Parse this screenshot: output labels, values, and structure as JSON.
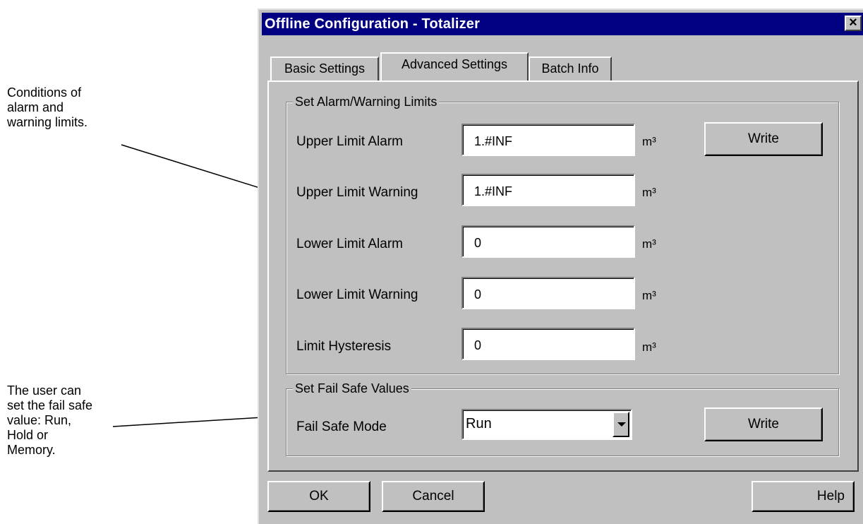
{
  "annotations": {
    "alarm_note": [
      "Conditions of",
      "alarm and",
      "warning limits."
    ],
    "failsafe_note": [
      "The user can",
      "set the fail safe",
      "value: Run,",
      "Hold or",
      "Memory."
    ]
  },
  "dialog": {
    "title": "Offline Configuration - Totalizer",
    "close_glyph": "×",
    "tabs": [
      {
        "label": "Basic Settings",
        "active": false
      },
      {
        "label": "Advanced Settings",
        "active": true
      },
      {
        "label": "Batch Info",
        "active": false
      }
    ],
    "alarm_group": {
      "title": "Set Alarm/Warning Limits",
      "write_label": "Write",
      "rows": [
        {
          "label": "Upper Limit Alarm",
          "value": "1.#INF",
          "unit": "m³"
        },
        {
          "label": "Upper Limit Warning",
          "value": "1.#INF",
          "unit": "m³"
        },
        {
          "label": "Lower Limit Alarm",
          "value": "0",
          "unit": "m³"
        },
        {
          "label": "Lower Limit Warning",
          "value": "0",
          "unit": "m³"
        },
        {
          "label": "Limit Hysteresis",
          "value": "0",
          "unit": "m³"
        }
      ]
    },
    "failsafe_group": {
      "title": "Set Fail Safe Values",
      "mode_label": "Fail Safe Mode",
      "mode_value": "Run",
      "write_label": "Write"
    },
    "footer": {
      "ok_label": "OK",
      "cancel_label": "Cancel",
      "help_label": "Help"
    }
  },
  "colors": {
    "title_bar": "#000080",
    "face": "#c0c0c0"
  }
}
